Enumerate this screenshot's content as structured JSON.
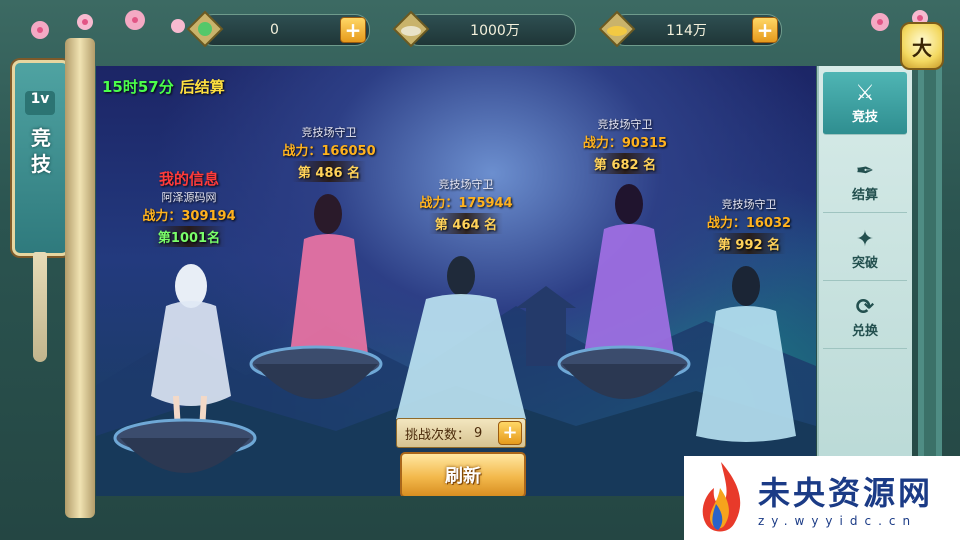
{
  "resources": [
    {
      "icon": "jade-icon",
      "value": "0"
    },
    {
      "icon": "silver-ingot-icon",
      "value": "1000万"
    },
    {
      "icon": "gold-ingot-icon",
      "value": "114万"
    }
  ],
  "side_scroll": {
    "badge": "1v",
    "title_line1": "竞",
    "title_line2": "技"
  },
  "lantern_char": "大",
  "timer": {
    "time": "15时57分",
    "suffix": "后结算"
  },
  "players": [
    {
      "name": "我的信息",
      "subtitle": "阿泽源码网",
      "power": "战力：309194",
      "rank": "第1001名"
    },
    {
      "name": "竞技场守卫",
      "power": "战力：166050",
      "rank": "第 486 名"
    },
    {
      "name": "竞技场守卫",
      "power": "战力：175944",
      "rank": "第 464 名"
    },
    {
      "name": "竞技场守卫",
      "power": "战力：90315",
      "rank": "第 682 名"
    },
    {
      "name": "竞技场守卫",
      "power": "战力：16032",
      "rank": "第 992 名"
    }
  ],
  "challenge": {
    "label": "挑战次数：",
    "count": "9"
  },
  "refresh_label": "刷新",
  "tabs": [
    {
      "label": "竞技",
      "icon": "crossed-swords-icon",
      "active": true
    },
    {
      "label": "结算",
      "icon": "quill-icon",
      "active": false
    },
    {
      "label": "突破",
      "icon": "breakthrough-icon",
      "active": false
    },
    {
      "label": "兑换",
      "icon": "exchange-icon",
      "active": false
    }
  ],
  "watermark": {
    "main": "未央资源网",
    "sub": "zy.wyyidc.cn"
  },
  "colors": {
    "timer": "#4bff4b",
    "suffix": "#ffe040",
    "power": "#ffb21e",
    "self_name": "#ff3b3b",
    "accent_teal": "#2f8e90"
  }
}
